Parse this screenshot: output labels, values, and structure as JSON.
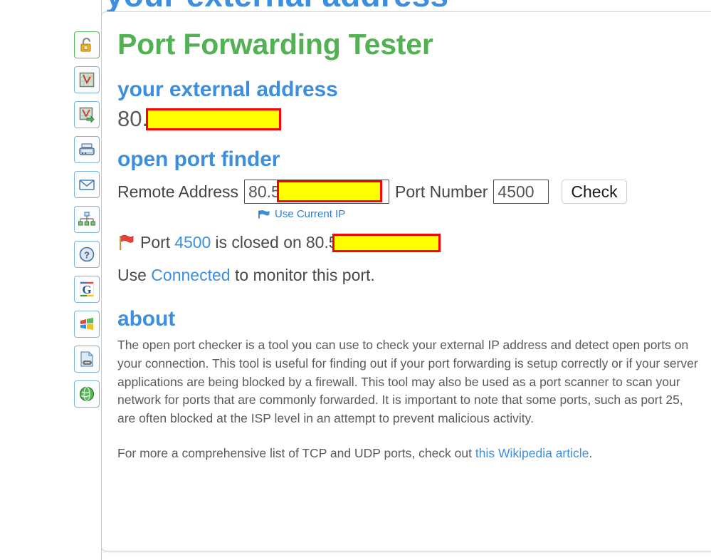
{
  "page": {
    "cutoff_heading": "your external address",
    "background": "#ffffff"
  },
  "colors": {
    "title_green": "#52b152",
    "heading_blue": "#3d8fdd",
    "link_blue": "#2a7fd4",
    "body_gray": "#5a5a5a",
    "redact_fill": "#ffff00",
    "redact_border": "#ff0000"
  },
  "sidebar": {
    "items": [
      {
        "name": "open-padlock-icon",
        "label": "Open Padlock",
        "active": true
      },
      {
        "name": "map-trace-icon",
        "label": "Visual Trace Route",
        "active": false
      },
      {
        "name": "map-export-icon",
        "label": "Trace Route Export",
        "active": false
      },
      {
        "name": "fax-icon",
        "label": "Fax Lookup",
        "active": false
      },
      {
        "name": "envelope-icon",
        "label": "Email Tools",
        "active": false
      },
      {
        "name": "network-diagram-icon",
        "label": "Network Tools",
        "active": false
      },
      {
        "name": "question-mark-icon",
        "label": "Help",
        "active": false
      },
      {
        "name": "google-g-icon",
        "label": "Google",
        "active": false
      },
      {
        "name": "windows-flag-icon",
        "label": "Windows",
        "active": false
      },
      {
        "name": "document-link-icon",
        "label": "Page Links",
        "active": false
      },
      {
        "name": "green-globe-icon",
        "label": "Web Tools",
        "active": false
      }
    ]
  },
  "card": {
    "title": "Port Forwarding Tester",
    "external_address": {
      "heading": "your external address",
      "value_prefix": "80.5",
      "redacted": true
    },
    "open_port_finder": {
      "heading": "open port finder",
      "remote_address_label": "Remote Address",
      "remote_address_value": "80.5",
      "port_number_label": "Port Number",
      "port_number_value": "4500",
      "check_button": "Check",
      "use_current_ip": "Use Current IP",
      "use_current_ip_icon": "flag-icon"
    },
    "result": {
      "icon": "red-flag-icon",
      "prefix": "Port",
      "port": "4500",
      "middle": "is closed on",
      "host_prefix": "80.5",
      "redacted": true
    },
    "monitor": {
      "before": "Use",
      "link": "Connected",
      "after": "to monitor this port."
    },
    "about": {
      "heading": "about",
      "paragraph_1": "The open port checker is a tool you can use to check your external IP address and detect open ports on your connection. This tool is useful for finding out if your port forwarding is setup correctly or if your server applications are being blocked by a firewall. This tool may also be used as a port scanner to scan your network for ports that are commonly forwarded. It is important to note that some ports, such as port 25, are often blocked at the ISP level in an attempt to prevent malicious activity.",
      "paragraph_2_before": "For more a comprehensive list of TCP and UDP ports, check out",
      "paragraph_2_link": "this Wikipedia article",
      "paragraph_2_after": "."
    }
  }
}
